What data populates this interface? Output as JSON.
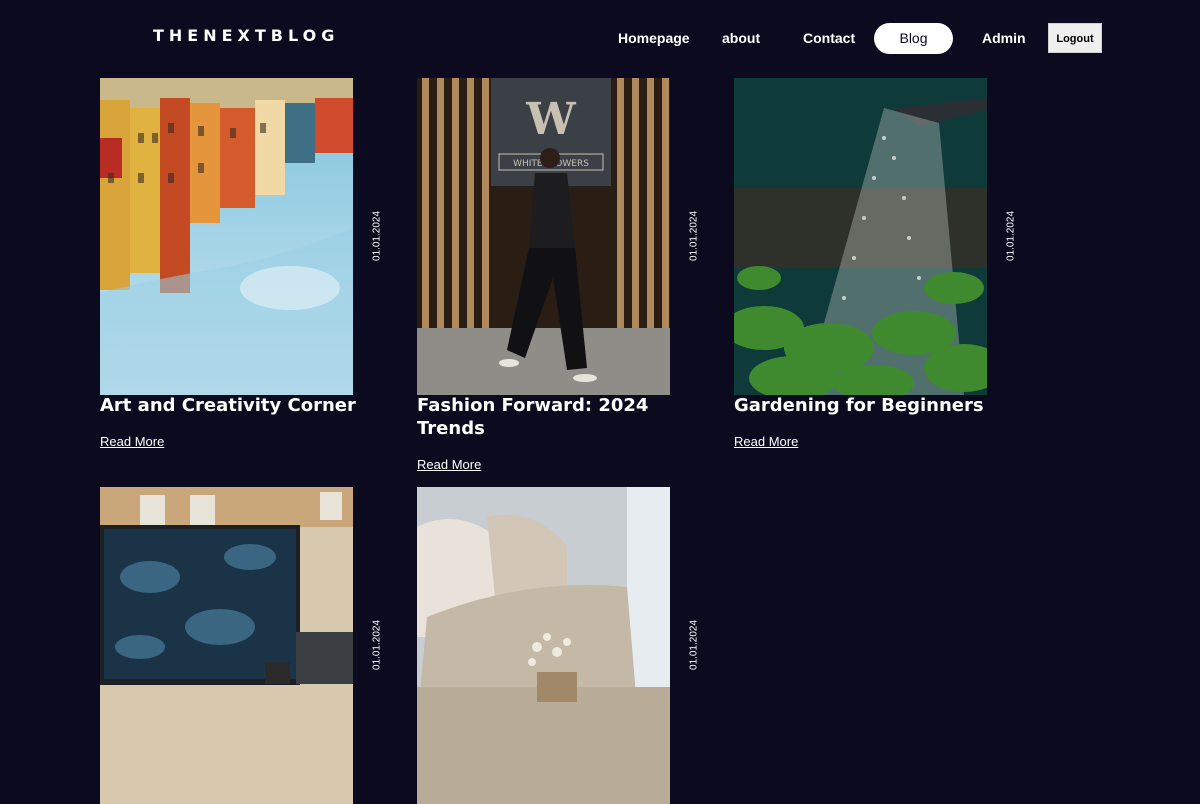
{
  "brand": {
    "logo": "THENEXTBLOG"
  },
  "nav": {
    "items": [
      {
        "label": "Homepage"
      },
      {
        "label": "about"
      },
      {
        "label": "Contact"
      },
      {
        "label": "Blog"
      },
      {
        "label": "Admin"
      }
    ],
    "active": "Blog",
    "logout_label": "Logout"
  },
  "posts": [
    {
      "title": "Art and Creativity Corner",
      "date": "01.01.2024",
      "read_more": "Read More"
    },
    {
      "title": "Fashion Forward: 2024 Trends",
      "date": "01.01.2024",
      "read_more": "Read More"
    },
    {
      "title": "Gardening for Beginners",
      "date": "01.01.2024",
      "read_more": "Read More"
    },
    {
      "title": "",
      "date": "01.01.2024",
      "read_more": ""
    },
    {
      "title": "",
      "date": "01.01.2024",
      "read_more": ""
    }
  ],
  "colors": {
    "background": "#0b0a1f",
    "text": "#ffffff",
    "active_pill": "#ffffff"
  },
  "image_text": {
    "store_sign": "WHITE FLOWERS"
  }
}
